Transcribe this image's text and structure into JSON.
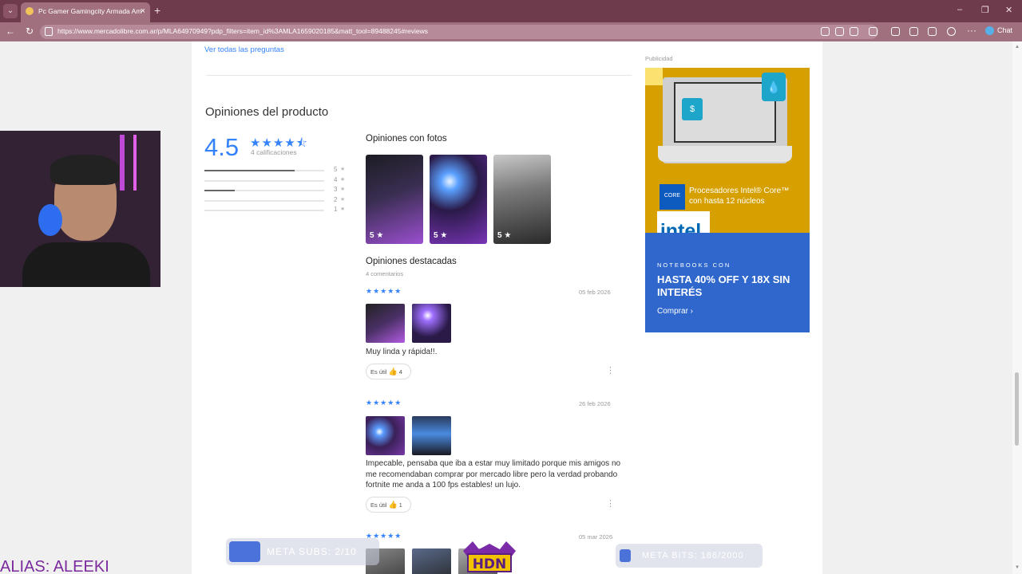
{
  "browser": {
    "tab_title": "Pc Gamer Gamingcity Armada Am",
    "url": "https://www.mercadolibre.com.ar/p/MLA64970949?pdp_filters=item_id%3AMLA1659020185&matt_tool=89488245#reviews",
    "chat_label": "Chat"
  },
  "page": {
    "see_all_questions": "Ver todas las preguntas",
    "section_title": "Opiniones del producto",
    "rating_average": "4.5",
    "rating_stars": "★★★★⯪",
    "rating_count": "4 calificaciones",
    "rating_breakdown": [
      {
        "stars": "5",
        "fraction": 0.75
      },
      {
        "stars": "4",
        "fraction": 0
      },
      {
        "stars": "3",
        "fraction": 0.25
      },
      {
        "stars": "2",
        "fraction": 0
      },
      {
        "stars": "1",
        "fraction": 0
      }
    ],
    "photos_title": "Opiniones con fotos",
    "photo_ratings": [
      "5 ★",
      "5 ★",
      "5 ★"
    ],
    "featured_title": "Opiniones destacadas",
    "featured_count": "4 comentarios",
    "helpful_label": "Es útil",
    "reviews": [
      {
        "stars": "★★★★★",
        "date": "05 feb 2026",
        "text": "Muy linda y rápida!!.",
        "helpful": "4"
      },
      {
        "stars": "★★★★★",
        "date": "26 feb 2026",
        "text": "Impecable, pensaba que iba a estar muy limitado porque mis amigos no me recomendaban comprar por mercado libre pero la verdad probando fortnite me anda a 100 fps estables! un lujo.",
        "helpful": "1"
      },
      {
        "stars": "★★★★★",
        "date": "05 mar 2026"
      }
    ]
  },
  "ad": {
    "label": "Publicidad",
    "processors": "Procesadores Intel® Core™ con hasta 12 núcleos",
    "core_badge": "CORE",
    "logo": "intel.",
    "notebooks": "NOTEBOOKS CON",
    "headline": "HASTA 40% OFF Y 18X SIN INTERÉS",
    "buy": "Comprar ›"
  },
  "overlay": {
    "meta_subs": "META SUBS: 2/10",
    "meta_bits": "META BITS: 186/2000",
    "alias": "ALIAS: ALEEKI",
    "hdn_logo": "HDN"
  },
  "colors": {
    "accent": "#3483fa",
    "tab_bar": "#6e3b4c",
    "address_bar": "#a0707f",
    "ad_yellow": "#d5a000",
    "ad_blue": "#2f67cc"
  }
}
